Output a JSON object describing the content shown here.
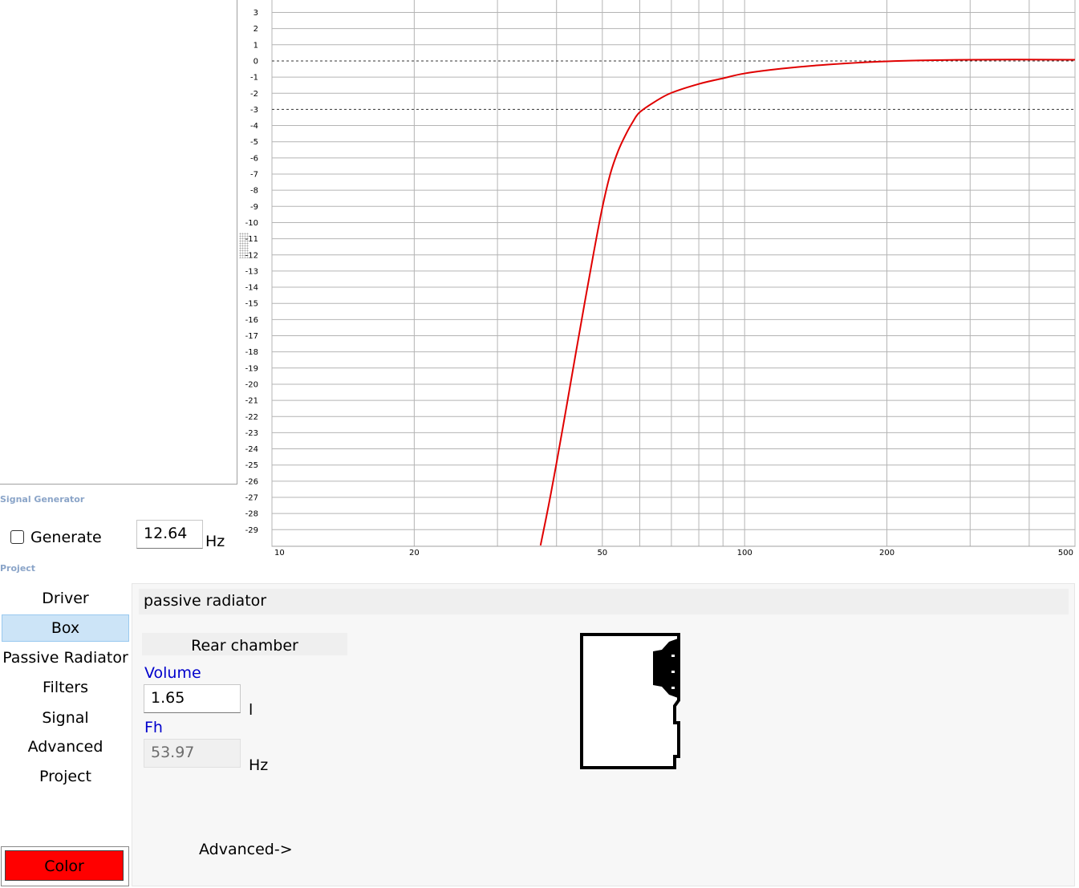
{
  "signal_generator": {
    "group_label": "Signal Generator",
    "generate_label": "Generate",
    "generate_checked": false,
    "frequency_value": "12.64",
    "frequency_unit": "Hz"
  },
  "project": {
    "group_label": "Project",
    "nav": [
      "Driver",
      "Box",
      "Passive Radiator",
      "Filters",
      "Signal",
      "Advanced",
      "Project"
    ],
    "selected": "Box",
    "color_button": "Color"
  },
  "box_panel": {
    "title": "passive radiator",
    "rear_chamber": "Rear chamber",
    "volume_label": "Volume",
    "volume_value": "1.65",
    "volume_unit": "l",
    "fh_label": "Fh",
    "fh_value": "53.97",
    "fh_unit": "Hz",
    "advanced_link": "Advanced->"
  },
  "colors": {
    "curve": "#e00000",
    "grid": "#b4b4b4",
    "selected_nav": "#cce4f7",
    "label_blue": "#0000cc",
    "color_swatch": "#ff0000"
  },
  "chart_data": {
    "type": "line",
    "x_scale": "log",
    "xlim": [
      10,
      500
    ],
    "ylim": [
      -29.2,
      3
    ],
    "x_ticks": [
      10,
      20,
      50,
      100,
      200,
      500
    ],
    "y_ticks": [
      3,
      2,
      1,
      0,
      -1,
      -2,
      -3,
      -4,
      -5,
      -6,
      -7,
      -8,
      -9,
      -10,
      -11,
      -12,
      -13,
      -14,
      -15,
      -16,
      -17,
      -18,
      -19,
      -20,
      -21,
      -22,
      -23,
      -24,
      -25,
      -26,
      -27,
      -28,
      -29
    ],
    "reference_lines": [
      0,
      -3
    ],
    "grid": true,
    "series": [
      {
        "x": [
          37,
          38.5,
          40,
          42,
          44,
          46,
          48,
          50,
          52,
          54,
          56,
          58,
          60,
          65,
          70,
          80,
          90,
          100,
          120,
          150,
          200,
          300,
          500
        ],
        "y": [
          -30,
          -27.5,
          -24.9,
          -21.4,
          -18.0,
          -14.8,
          -11.8,
          -9.1,
          -7.0,
          -5.6,
          -4.6,
          -3.8,
          -3.2,
          -2.5,
          -2.0,
          -1.45,
          -1.1,
          -0.8,
          -0.5,
          -0.25,
          -0.05,
          0.05,
          0.05
        ]
      }
    ]
  }
}
